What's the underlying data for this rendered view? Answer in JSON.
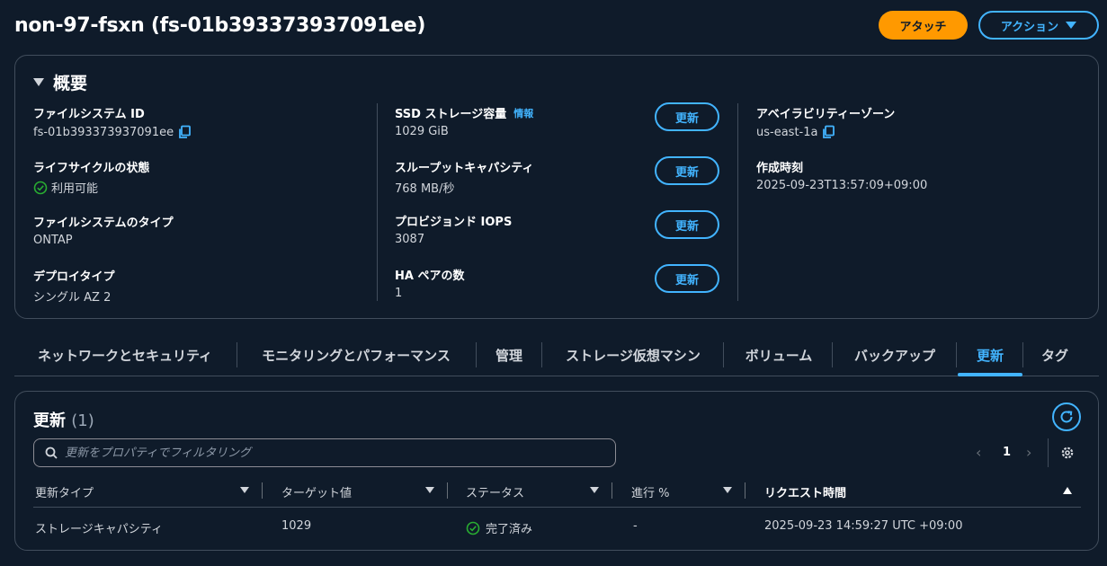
{
  "header": {
    "title": "non-97-fsxn (fs-01b393373937091ee)",
    "attach_label": "アタッチ",
    "action_label": "アクション"
  },
  "summary": {
    "title": "概要",
    "col1": [
      {
        "key": "ファイルシステム ID",
        "value": "fs-01b393373937091ee"
      },
      {
        "key": "ライフサイクルの状態",
        "value": "利用可能"
      },
      {
        "key": "ファイルシステムのタイプ",
        "value": "ONTAP"
      },
      {
        "key": "デプロイタイプ",
        "value": "シングル AZ 2"
      }
    ],
    "col2": [
      {
        "key": "SSD ストレージ容量",
        "info": "情報",
        "value": "1029 GiB",
        "button": "更新"
      },
      {
        "key": "スループットキャパシティ",
        "value": "768 MB/秒",
        "button": "更新"
      },
      {
        "key": "プロビジョンド IOPS",
        "value": "3087",
        "button": "更新"
      },
      {
        "key": "HA ペアの数",
        "value": "1",
        "button": "更新"
      }
    ],
    "col3": [
      {
        "key": "アベイラビリティーゾーン",
        "value": "us-east-1a"
      },
      {
        "key": "作成時刻",
        "value": "2025-09-23T13:57:09+09:00"
      }
    ]
  },
  "tabs": [
    {
      "label": "ネットワークとセキュリティ",
      "active": false
    },
    {
      "label": "モニタリングとパフォーマンス",
      "active": false
    },
    {
      "label": "管理",
      "active": false
    },
    {
      "label": "ストレージ仮想マシン",
      "active": false
    },
    {
      "label": "ボリューム",
      "active": false
    },
    {
      "label": "バックアップ",
      "active": false
    },
    {
      "label": "更新",
      "active": true
    },
    {
      "label": "タグ",
      "active": false
    }
  ],
  "updates": {
    "title": "更新",
    "count": "(1)",
    "search_placeholder": "更新をプロパティでフィルタリング",
    "page": "1",
    "columns": [
      "更新タイプ",
      "ターゲット値",
      "ステータス",
      "進行 %",
      "リクエスト時間"
    ],
    "rows": [
      {
        "type": "ストレージキャパシティ",
        "target": "1029",
        "status": "完了済み",
        "progress": "-",
        "requested": "2025-09-23 14:59:27 UTC +09:00"
      }
    ]
  },
  "colors": {
    "background": "#0f1b2a",
    "accent": "#42b4ff",
    "primary_button": "#ff9900",
    "success": "#29ad32",
    "border": "#414d5c"
  }
}
